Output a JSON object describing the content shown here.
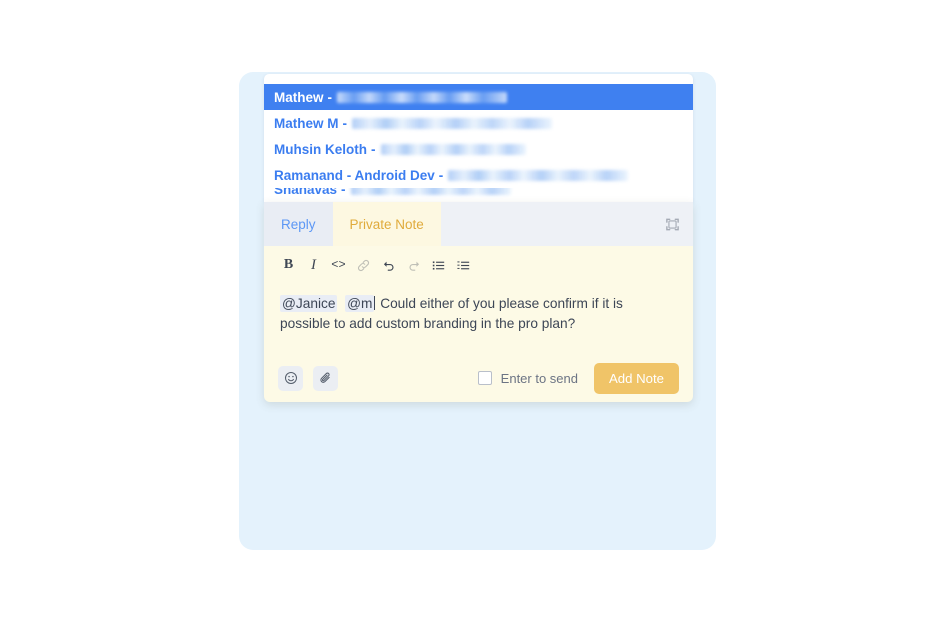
{
  "mention_dropdown": {
    "items": [
      {
        "name": "Mathew",
        "separator": "-",
        "email_redacted": true,
        "email_width": 170,
        "selected": true
      },
      {
        "name": "Mathew M",
        "separator": "-",
        "email_redacted": true,
        "email_width": 200,
        "selected": false
      },
      {
        "name": "Muhsin Keloth",
        "separator": "-",
        "email_redacted": true,
        "email_width": 145,
        "selected": false
      },
      {
        "name": "Ramanand - Android Dev",
        "separator": "-",
        "email_redacted": true,
        "email_width": 180,
        "selected": false
      },
      {
        "name": "Shanavas",
        "separator": "-",
        "email_redacted": true,
        "email_width": 160,
        "selected": false
      }
    ]
  },
  "composer": {
    "tabs": [
      {
        "id": "reply",
        "label": "Reply",
        "active": false
      },
      {
        "id": "private-note",
        "label": "Private Note",
        "active": true
      }
    ],
    "expand_icon": "expand-icon",
    "toolbar": [
      {
        "id": "bold",
        "label": "B",
        "icon": "bold-icon",
        "dim": false
      },
      {
        "id": "italic",
        "label": "I",
        "icon": "italic-icon",
        "dim": false
      },
      {
        "id": "code",
        "label": "<>",
        "icon": "code-icon",
        "dim": false
      },
      {
        "id": "link",
        "label": "",
        "icon": "link-icon",
        "dim": true
      },
      {
        "id": "undo",
        "label": "",
        "icon": "undo-icon",
        "dim": false
      },
      {
        "id": "redo",
        "label": "",
        "icon": "redo-icon",
        "dim": true
      },
      {
        "id": "bullet-list",
        "label": "",
        "icon": "bullet-list-icon",
        "dim": false
      },
      {
        "id": "ordered-list",
        "label": "",
        "icon": "ordered-list-icon",
        "dim": false
      }
    ],
    "message": {
      "mention_1": "@Janice",
      "mention_2": "@m",
      "text": "Could either of you please confirm if it is possible to add custom branding in the pro plan?"
    },
    "actions": {
      "emoji_icon": "emoji-icon",
      "attachment_icon": "paperclip-icon",
      "enter_to_send_label": "Enter to send",
      "enter_to_send_checked": false,
      "submit_label": "Add Note"
    }
  },
  "colors": {
    "selected_row": "#3f80f0",
    "mention_name": "#3b7df0",
    "reply_tab_text": "#5c97f5",
    "private_note_text": "#e0ab3c",
    "note_background": "#fdfae6",
    "submit_button": "#f0c468",
    "backdrop_panel": "#e4f2fc"
  }
}
